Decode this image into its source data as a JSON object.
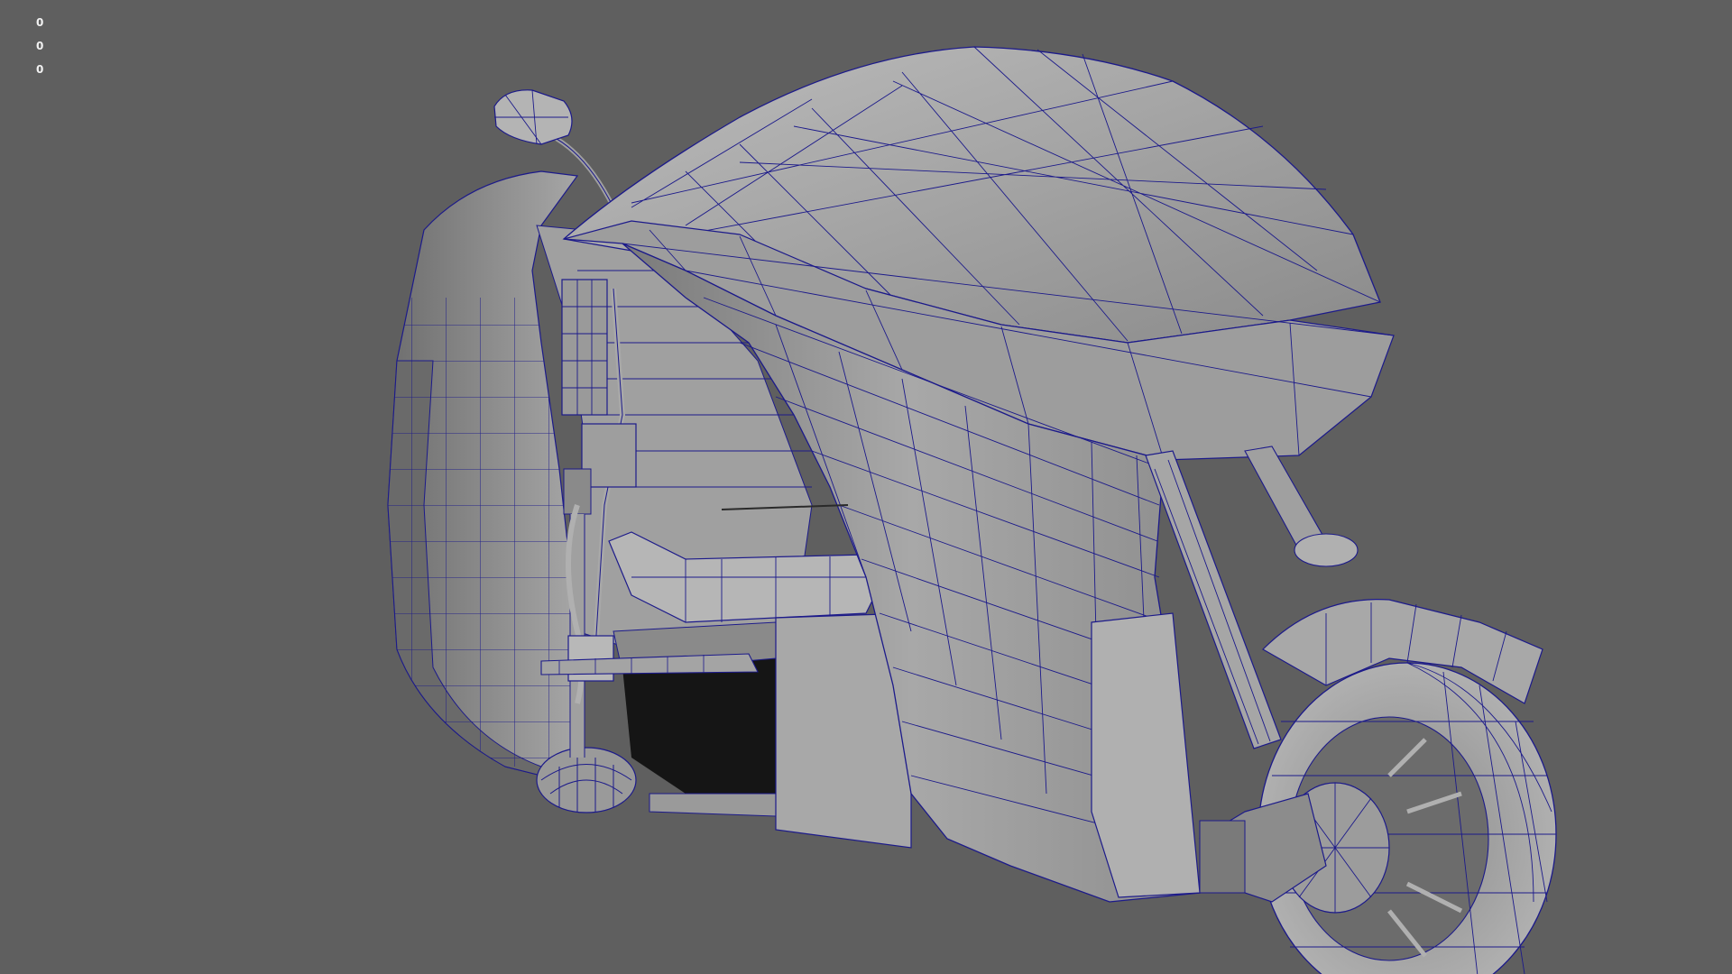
{
  "viewport": {
    "background": "#5f5f5f",
    "wireframe_color": "#1c1a8a",
    "shade_light": "#b2b2b2",
    "shade_mid": "#8f8f8f",
    "shade_dark": "#6a6a6a",
    "shadow": "#1a1a1a"
  },
  "hud": {
    "lines": [
      "0",
      "0",
      "0"
    ]
  }
}
